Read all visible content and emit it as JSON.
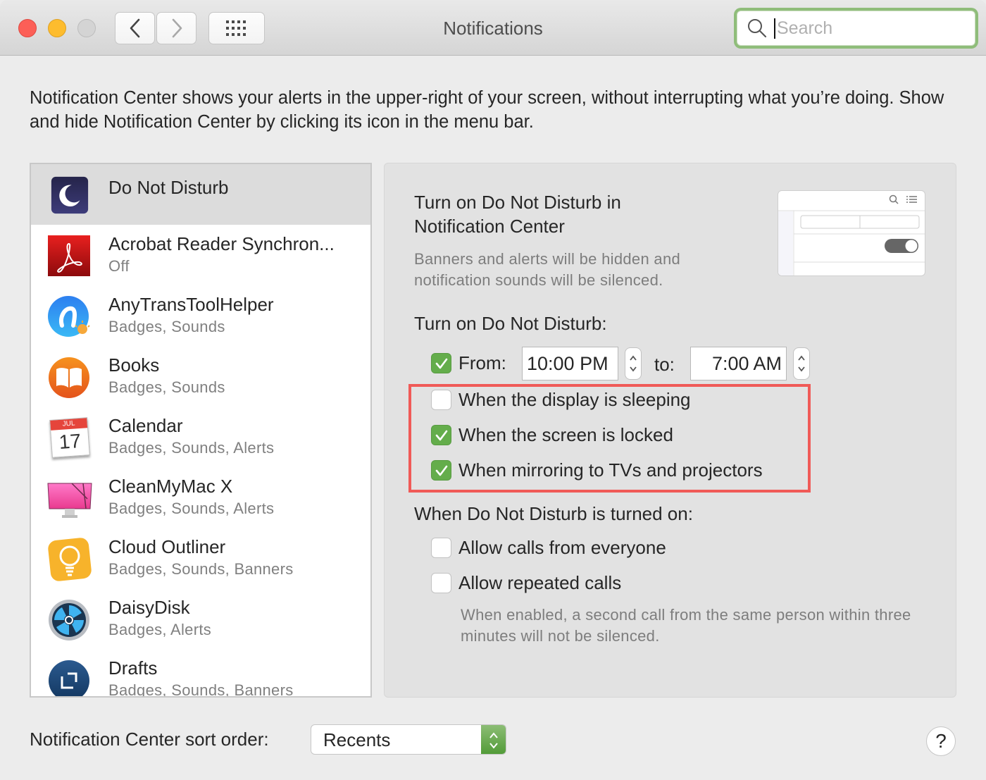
{
  "window": {
    "title": "Notifications",
    "search": {
      "placeholder": "Search",
      "value": ""
    }
  },
  "toolbar": {
    "back_icon": "chevron-left-icon",
    "forward_icon": "chevron-right-icon",
    "show_all_icon": "grid-icon"
  },
  "intro_text": "Notification Center shows your alerts in the upper-right of your screen, without interrupting what you’re doing. Show and hide Notification Center by clicking its icon in the menu bar.",
  "sidebar": {
    "items": [
      {
        "name": "Do Not Disturb",
        "subtitle": "",
        "icon": "moon-icon",
        "selected": true
      },
      {
        "name": "Acrobat Reader Synchron...",
        "subtitle": "Off",
        "icon": "acrobat-icon",
        "selected": false
      },
      {
        "name": "AnyTransToolHelper",
        "subtitle": "Badges, Sounds",
        "icon": "anytrans-icon",
        "selected": false
      },
      {
        "name": "Books",
        "subtitle": "Badges, Sounds",
        "icon": "books-icon",
        "selected": false
      },
      {
        "name": "Calendar",
        "subtitle": "Badges, Sounds, Alerts",
        "icon": "calendar-icon",
        "selected": false,
        "calendar_month": "JUL",
        "calendar_day": "17"
      },
      {
        "name": "CleanMyMac X",
        "subtitle": "Badges, Sounds, Alerts",
        "icon": "cleanmymac-icon",
        "selected": false
      },
      {
        "name": "Cloud Outliner",
        "subtitle": "Badges, Sounds, Banners",
        "icon": "cloud-outliner-icon",
        "selected": false
      },
      {
        "name": "DaisyDisk",
        "subtitle": "Badges, Alerts",
        "icon": "daisydisk-icon",
        "selected": false
      },
      {
        "name": "Drafts",
        "subtitle": "Badges, Sounds, Banners",
        "icon": "drafts-icon",
        "selected": false
      }
    ]
  },
  "dnd": {
    "nc_heading": "Turn on Do Not Disturb in Notification Center",
    "nc_description": "Banners and alerts will be hidden and notification sounds will be silenced.",
    "schedule_label": "Turn on Do Not Disturb:",
    "from": {
      "label": "From:",
      "checked": true,
      "value": "10:00 PM"
    },
    "to": {
      "label": "to:",
      "value": "7:00 AM"
    },
    "conditions": [
      {
        "label": "When the display is sleeping",
        "checked": false
      },
      {
        "label": "When the screen is locked",
        "checked": true
      },
      {
        "label": "When mirroring to TVs and projectors",
        "checked": true
      }
    ],
    "when_on_label": "When Do Not Disturb is turned on:",
    "calls": [
      {
        "label": "Allow calls from everyone",
        "checked": false
      },
      {
        "label": "Allow repeated calls",
        "checked": false
      }
    ],
    "repeated_note": "When enabled, a second call from the same person within three minutes will not be silenced."
  },
  "footer": {
    "sort_label": "Notification Center sort order:",
    "sort_value": "Recents",
    "help_label": "?"
  },
  "colors": {
    "checkbox_on": "#64ad4b",
    "highlight_box": "#f05a57",
    "focus_ring": "#8fbd7a",
    "select_arrow": "#5ea044"
  }
}
